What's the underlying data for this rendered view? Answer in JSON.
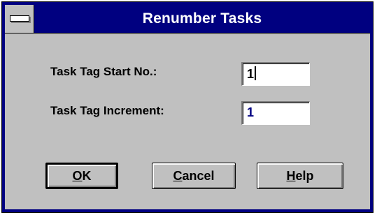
{
  "window": {
    "title": "Renumber Tasks"
  },
  "fields": {
    "start": {
      "label": "Task Tag Start No.:",
      "value": "1"
    },
    "increment": {
      "label": "Task Tag Increment:",
      "value": "1"
    }
  },
  "buttons": {
    "ok": {
      "mnemonic": "O",
      "rest": "K"
    },
    "cancel": {
      "mnemonic": "C",
      "rest": "ancel"
    },
    "help": {
      "mnemonic": "H",
      "rest": "elp"
    }
  },
  "colors": {
    "titlebar": "#000080",
    "face": "#c0c0c0",
    "increment_text": "#000080"
  }
}
